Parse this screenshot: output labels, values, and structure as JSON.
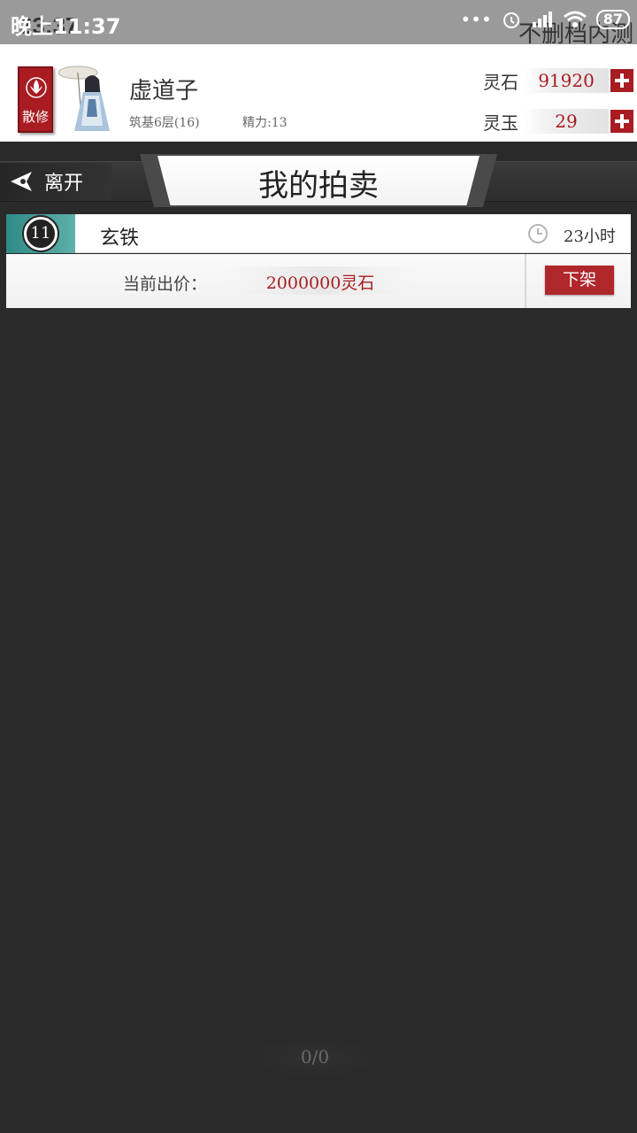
{
  "statusbar": {
    "time": "晚上11:37",
    "game_time": "23:37",
    "battery": "87",
    "overlay_text": "不删档内测"
  },
  "player": {
    "sect": "散修",
    "name": "虚道子",
    "level": "筑基6层(16)",
    "stamina": "精力:13"
  },
  "currencies": [
    {
      "label": "灵石",
      "value": "91920"
    },
    {
      "label": "灵玉",
      "value": "29"
    }
  ],
  "titlebar": {
    "leave_label": "离开",
    "title": "我的拍卖"
  },
  "auction_items": [
    {
      "level": "11",
      "name": "玄铁",
      "time_left": "23小时",
      "price_label": "当前出价：",
      "price_value": "2000000灵石",
      "action_label": "下架"
    }
  ],
  "pager": {
    "text": "0/0"
  },
  "colors": {
    "accent_red": "#a81c22",
    "background": "#2a2a2a",
    "teal": "#2f8a86"
  }
}
